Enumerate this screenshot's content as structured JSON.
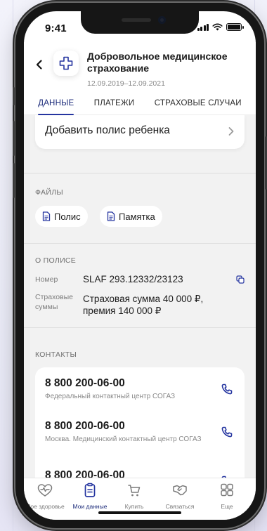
{
  "status_bar": {
    "time": "9:41"
  },
  "header": {
    "title": "Добровольное медицинское страхование",
    "dates": "12.09.2019–12.09.2021"
  },
  "tabs": [
    {
      "label": "ДАННЫЕ",
      "active": true
    },
    {
      "label": "ПЛАТЕЖИ",
      "active": false
    },
    {
      "label": "СТРАХОВЫЕ СЛУЧАИ",
      "active": false
    }
  ],
  "add_child": {
    "label": "Добавить полис ребенка"
  },
  "files": {
    "title": "ФАЙЛЫ",
    "items": [
      {
        "label": "Полис"
      },
      {
        "label": "Памятка"
      }
    ]
  },
  "policy": {
    "title": "О ПОЛИСЕ",
    "number_label": "Номер",
    "number_value": "SLAF 293.12332/23123",
    "sums_label_line1": "Страховые",
    "sums_label_line2": "суммы",
    "sums_value_line1": "Страховая сумма 40 000 ₽,",
    "sums_value_line2": "премия 140 000 ₽"
  },
  "contacts": {
    "title": "КОНТАКТЫ",
    "items": [
      {
        "phone": "8 800 200-06-00",
        "description": "Федеральный контактный центр СОГАЗ"
      },
      {
        "phone": "8 800 200-06-00",
        "description": "Москва. Медицинский контактный центр СОГАЗ"
      },
      {
        "phone": "8 800 200-06-00",
        "description": ""
      }
    ]
  },
  "bottom_nav": [
    {
      "label": "Мое здоровье",
      "icon": "heart-pulse-icon",
      "active": false
    },
    {
      "label": "Мои данные",
      "icon": "clipboard-icon",
      "active": true
    },
    {
      "label": "Купить",
      "icon": "cart-icon",
      "active": false
    },
    {
      "label": "Связаться",
      "icon": "handshake-icon",
      "active": false
    },
    {
      "label": "Еще",
      "icon": "grid-icon",
      "active": false
    }
  ],
  "colors": {
    "accent": "#2535a0",
    "background": "#f2f2f2",
    "text": "#1b1b1b"
  }
}
